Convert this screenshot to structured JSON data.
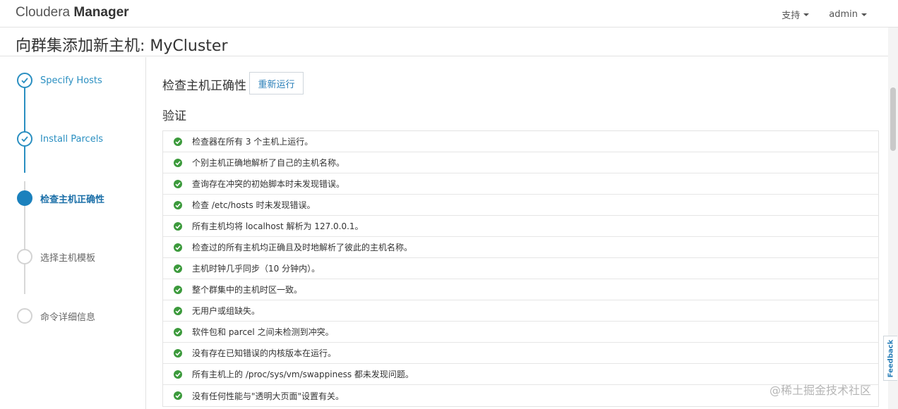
{
  "header": {
    "brand_light": "Cloudera ",
    "brand_bold": "Manager",
    "support_label": "支持",
    "user_label": "admin"
  },
  "page": {
    "title": "向群集添加新主机: MyCluster"
  },
  "wizard": {
    "steps": [
      {
        "label": "Specify Hosts",
        "status": "done"
      },
      {
        "label": "Install Parcels",
        "status": "done"
      },
      {
        "label": "检查主机正确性",
        "status": "current"
      },
      {
        "label": "选择主机模板",
        "status": "pending"
      },
      {
        "label": "命令详细信息",
        "status": "pending"
      }
    ]
  },
  "main": {
    "section_title": "检查主机正确性",
    "rerun_label": "重新运行",
    "subtitle": "验证",
    "checks": [
      "检查器在所有 3 个主机上运行。",
      "个别主机正确地解析了自己的主机名称。",
      "查询存在冲突的初始脚本时未发现错误。",
      "检查 /etc/hosts 时未发现错误。",
      "所有主机均将 localhost 解析为 127.0.0.1。",
      "检查过的所有主机均正确且及时地解析了彼此的主机名称。",
      "主机时钟几乎同步（10 分钟内）。",
      "整个群集中的主机时区一致。",
      "无用户或组缺失。",
      "软件包和 parcel 之间未检测到冲突。",
      "没有存在已知错误的内核版本在运行。",
      "所有主机上的 /proc/sys/vm/swappiness 都未发现问题。",
      "没有任何性能与\"透明大页面\"设置有关。"
    ]
  },
  "feedback_label": "Feedback",
  "watermark": "@稀土掘金技术社区",
  "colors": {
    "accent": "#2a8fc1",
    "success": "#3c9a3c",
    "border": "#e2e2e2"
  }
}
